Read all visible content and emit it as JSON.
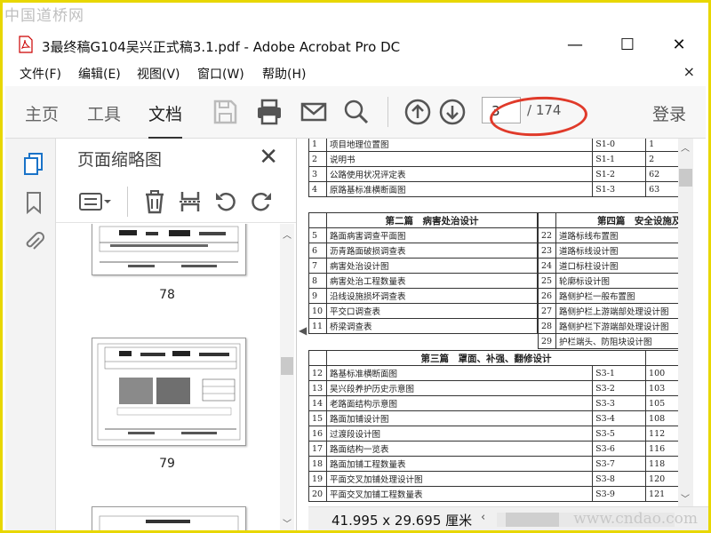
{
  "watermark": {
    "top": "中国道桥网",
    "bottom": "www.cndao.com"
  },
  "window": {
    "title": "3最终稿G104吴兴正式稿3.1.pdf - Adobe Acrobat Pro DC",
    "minimize": "—",
    "maximize": "☐",
    "close": "✕"
  },
  "menu": {
    "items": [
      "文件(F)",
      "编辑(E)",
      "视图(V)",
      "窗口(W)",
      "帮助(H)"
    ],
    "close": "×"
  },
  "toolbar": {
    "tabs": [
      "主页",
      "工具",
      "文档"
    ],
    "active_tab": "文档",
    "current_page": "3",
    "total_pages": "/ 174",
    "login": "登录"
  },
  "thumbnails": {
    "title": "页面缩略图",
    "close": "✕",
    "pages": [
      "78",
      "79"
    ]
  },
  "status": {
    "dimensions": "41.995 x 29.695 厘米"
  },
  "colors": {
    "highlight_circle": "#e03a2a",
    "frame_border": "#e8d700"
  },
  "document": {
    "top_rows": [
      {
        "no": "1",
        "name": "项目地理位置图",
        "code": "S1-0",
        "page": "1"
      },
      {
        "no": "2",
        "name": "说明书",
        "code": "S1-1",
        "page": "2"
      },
      {
        "no": "3",
        "name": "公路使用状况评定表",
        "code": "S1-2",
        "page": "62"
      },
      {
        "no": "4",
        "name": "原路基标准横断面图",
        "code": "S1-3",
        "page": "63"
      }
    ],
    "section2_title": "第二篇　病害处治设计",
    "section2_rows": [
      {
        "no": "5",
        "name": "路面病害调查平面图"
      },
      {
        "no": "6",
        "name": "沥青路面破损调查表"
      },
      {
        "no": "7",
        "name": "病害处治设计图"
      },
      {
        "no": "8",
        "name": "病害处治工程数量表"
      },
      {
        "no": "9",
        "name": "沿线设施损坏调查表"
      },
      {
        "no": "10",
        "name": "平交口调查表"
      },
      {
        "no": "11",
        "name": "桥梁调查表"
      }
    ],
    "section4_title": "第四篇　安全设施及其他",
    "section4_rows": [
      {
        "no": "22",
        "name": "道路标线布置图"
      },
      {
        "no": "23",
        "name": "道路标线设计图"
      },
      {
        "no": "24",
        "name": "道口标柱设计图"
      },
      {
        "no": "25",
        "name": "轮廓标设计图"
      },
      {
        "no": "26",
        "name": "路侧护栏一般布置图"
      },
      {
        "no": "27",
        "name": "路侧护栏上游端部处理设计图"
      },
      {
        "no": "28",
        "name": "路侧护栏下游端部处理设计图"
      },
      {
        "no": "29",
        "name": "护栏端头、防阻块设计图"
      }
    ],
    "section3_title": "第三篇　罩面、补强、翻修设计",
    "section3_rows": [
      {
        "no": "12",
        "name": "路基标准横断面图",
        "code": "S3-1",
        "page": "100"
      },
      {
        "no": "13",
        "name": "吴兴段养护历史示意图",
        "code": "S3-2",
        "page": "103"
      },
      {
        "no": "14",
        "name": "老路面结构示意图",
        "code": "S3-3",
        "page": "105"
      },
      {
        "no": "15",
        "name": "路面加铺设计图",
        "code": "S3-4",
        "page": "108"
      },
      {
        "no": "16",
        "name": "过渡段设计图",
        "code": "S3-5",
        "page": "112"
      },
      {
        "no": "17",
        "name": "路面结构一览表",
        "code": "S3-6",
        "page": "116"
      },
      {
        "no": "18",
        "name": "路面加铺工程数量表",
        "code": "S3-7",
        "page": "118"
      },
      {
        "no": "19",
        "name": "平面交叉加铺处理设计图",
        "code": "S3-8",
        "page": "120"
      },
      {
        "no": "20",
        "name": "平面交叉加铺工程数量表",
        "code": "S3-9",
        "page": "121"
      }
    ]
  }
}
